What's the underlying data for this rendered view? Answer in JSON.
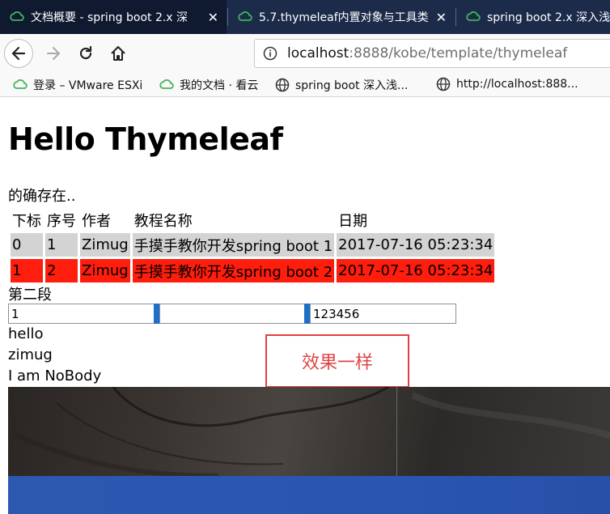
{
  "browser": {
    "tabs": [
      {
        "title": "文档概要 - spring boot 2.x 深",
        "active": true
      },
      {
        "title": "5.7.thymeleaf内置对象与工具类",
        "active": false
      },
      {
        "title": "spring boot 2.x 深入浅",
        "active": false
      }
    ],
    "url": {
      "host": "localhost",
      "rest": ":8888/kobe/template/thymeleaf"
    },
    "bookmarks": [
      {
        "label": "登录 – VMware ESXi",
        "icon": "cloud-icon"
      },
      {
        "label": "我的文档 · 看云",
        "icon": "cloud-icon"
      },
      {
        "label": "spring boot 深入浅...",
        "icon": "globe-icon"
      },
      {
        "label": "http://localhost:888...",
        "icon": "globe-icon"
      }
    ]
  },
  "page": {
    "heading": "Hello Thymeleaf",
    "exists_text": "的确存在..",
    "table": {
      "headers": [
        "下标",
        "序号",
        "作者",
        "教程名称",
        "日期"
      ],
      "rows": [
        [
          "0",
          "1",
          "Zimug",
          "手摸手教你开发spring boot 1",
          "2017-07-16 05:23:34"
        ],
        [
          "1",
          "2",
          "Zimug",
          "手摸手教你开发spring boot 2",
          "2017-07-16 05:23:34"
        ]
      ]
    },
    "section_two": "第二段",
    "inputs": {
      "first_value": "1",
      "middle_value": "",
      "last_value": "123456"
    },
    "lines": [
      "hello",
      "zimug",
      "I am NoBody"
    ],
    "annotation": "效果一样"
  },
  "colors": {
    "tab_bar": "#1c2b4a",
    "row_even": "#d3d3d3",
    "row_odd": "#ff1d0d",
    "annotation_red": "#e04545",
    "input_handle": "#1e6fc8"
  }
}
